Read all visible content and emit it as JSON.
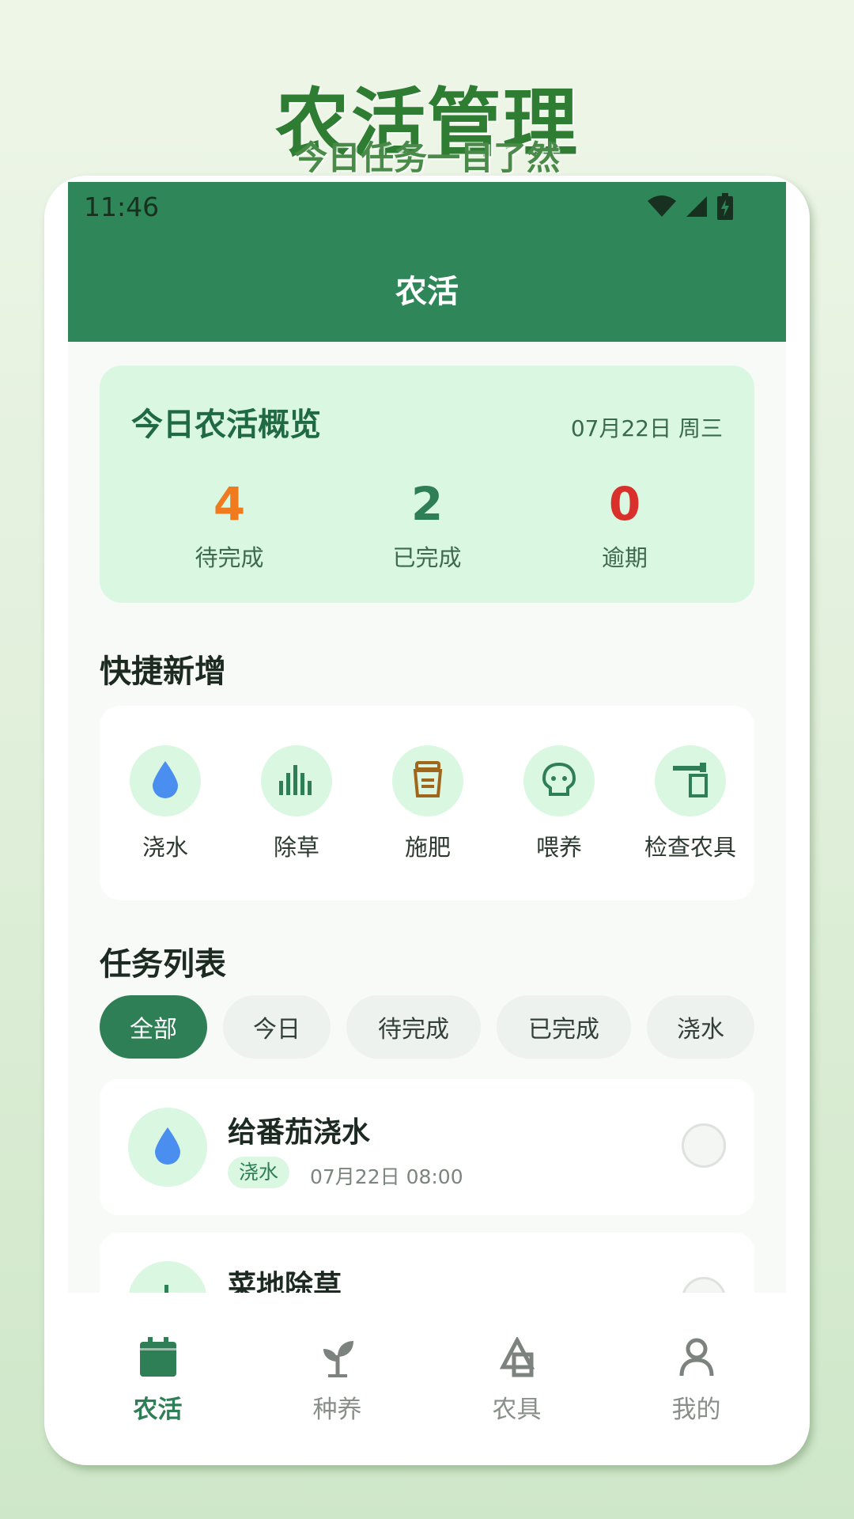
{
  "promo": {
    "title": "农活管理",
    "subtitle": "今日任务一目了然"
  },
  "status_bar": {
    "time": "11:46"
  },
  "header": {
    "title": "农活"
  },
  "overview": {
    "title": "今日农活概览",
    "date": "07月22日 周三",
    "stats": [
      {
        "value": "4",
        "label": "待完成",
        "color": "#f07b1e"
      },
      {
        "value": "2",
        "label": "已完成",
        "color": "#2e7f55"
      },
      {
        "value": "0",
        "label": "逾期",
        "color": "#d9302b"
      }
    ]
  },
  "quick_add": {
    "title": "快捷新增",
    "items": [
      {
        "label": "浇水",
        "icon": "water-drop-icon"
      },
      {
        "label": "除草",
        "icon": "grass-icon"
      },
      {
        "label": "施肥",
        "icon": "fertilizer-icon"
      },
      {
        "label": "喂养",
        "icon": "pet-feed-icon"
      },
      {
        "label": "检查农具",
        "icon": "tool-check-icon"
      }
    ]
  },
  "task_list": {
    "title": "任务列表",
    "filters": [
      "全部",
      "今日",
      "待完成",
      "已完成",
      "浇水"
    ],
    "active_filter": "全部",
    "tasks": [
      {
        "title": "给番茄浇水",
        "tag": "浇水",
        "time": "07月22日  08:00",
        "icon": "water-drop-icon"
      },
      {
        "title": "菜地除草",
        "tag": "",
        "time": "",
        "icon": "grass-icon"
      }
    ]
  },
  "bottom_nav": {
    "items": [
      {
        "label": "农活",
        "icon": "calendar-icon",
        "active": true
      },
      {
        "label": "种养",
        "icon": "sprout-icon",
        "active": false
      },
      {
        "label": "农具",
        "icon": "tool-icon",
        "active": false
      },
      {
        "label": "我的",
        "icon": "person-icon",
        "active": false
      }
    ]
  },
  "colors": {
    "primary": "#2e8659",
    "accent_light": "#daf7e2",
    "pending": "#f07b1e",
    "overdue": "#d9302b",
    "water": "#4a8ff0",
    "fertilizer": "#a0661c"
  }
}
